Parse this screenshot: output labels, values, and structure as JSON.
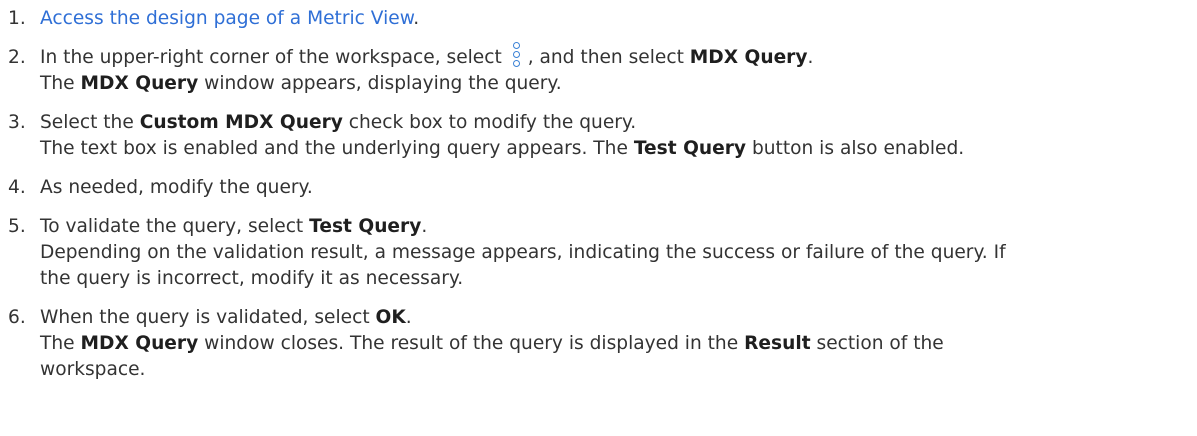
{
  "steps": [
    {
      "num": "1.",
      "link": "Access the design page of a Metric View",
      "after": "."
    },
    {
      "num": "2.",
      "pre": "In the upper-right corner of the workspace, select",
      "icon": "more-vertical-icon",
      "mid": ", and then select",
      "bold": "MDX Query",
      "post": ".",
      "l2_pre": "The",
      "l2_bold": "MDX Query",
      "l2_post": "window appears, displaying the query."
    },
    {
      "num": "3.",
      "pre": "Select the",
      "bold": "Custom MDX Query",
      "post": "check box to modify the query.",
      "l2_pre": "The text box is enabled and the underlying query appears. The",
      "l2_bold": "Test Query",
      "l2_post": "button is also enabled."
    },
    {
      "num": "4.",
      "text": "As needed, modify the query."
    },
    {
      "num": "5.",
      "pre": "To validate the query, select",
      "bold": "Test Query",
      "post": ".",
      "l2_a": "Depending on the validation result, a message appears, indicating the success or failure of the query. If",
      "l2_b": "the query is incorrect, modify it as necessary."
    },
    {
      "num": "6.",
      "pre": "When the query is validated, select",
      "bold": "OK",
      "post": ".",
      "l2_pre": "The",
      "l2_bold": "MDX Query",
      "l2_mid": "window closes. The result of the query is displayed in the",
      "l2_bold2": "Result",
      "l2_post": "section of the",
      "l3": "workspace."
    }
  ],
  "colors": {
    "link": "#2f6fd6",
    "text": "#333333",
    "icon": "#3b82d6"
  }
}
